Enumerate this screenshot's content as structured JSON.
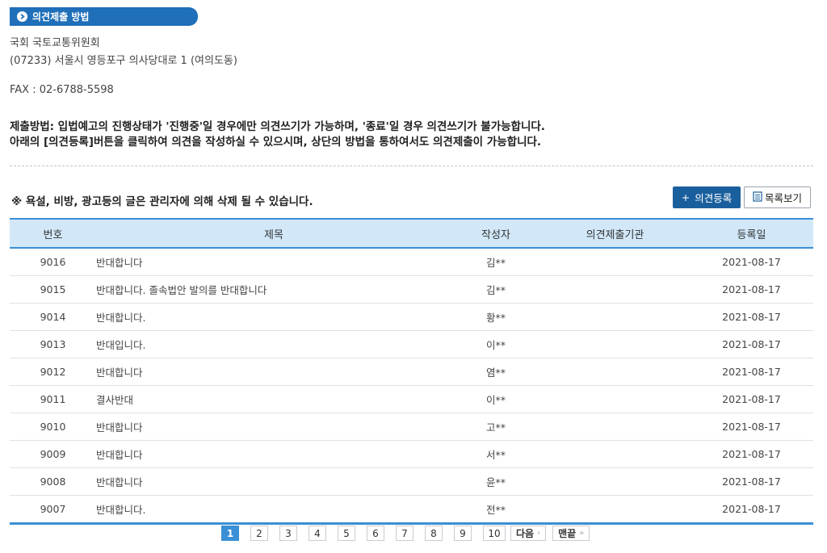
{
  "section": {
    "title": "의견제출 방법"
  },
  "address": {
    "org": "국회 국토교통위원회",
    "street": "(07233) 서울시 영등포구 의사당대로 1 (여의도동)",
    "fax": "FAX : 02-6788-5598"
  },
  "notice": {
    "line1": "제출방법: 입법예고의 진행상태가 '진행중'일 경우에만 의견쓰기가 가능하며, '종료'일 경우 의견쓰기가 불가능합니다.",
    "line2": "아래의 [의견등록]버튼을 클릭하여 의견을 작성하실 수 있으시며, 상단의 방법을 통하여서도 의견제출이 가능합니다."
  },
  "warning": "※ 욕설, 비방, 광고등의 글은 관리자에 의해 삭제 될 수 있습니다.",
  "buttons": {
    "register": "의견등록",
    "list": "목록보기"
  },
  "table": {
    "headers": {
      "no": "번호",
      "title": "제목",
      "author": "작성자",
      "org": "의견제출기관",
      "date": "등록일"
    },
    "rows": [
      {
        "no": "9016",
        "title": "반대합니다",
        "author": "김**",
        "org": "",
        "date": "2021-08-17"
      },
      {
        "no": "9015",
        "title": "반대합니다. 졸속법안 발의를 반대합니다",
        "author": "김**",
        "org": "",
        "date": "2021-08-17"
      },
      {
        "no": "9014",
        "title": "반대합니다.",
        "author": "황**",
        "org": "",
        "date": "2021-08-17"
      },
      {
        "no": "9013",
        "title": "반대입니다.",
        "author": "이**",
        "org": "",
        "date": "2021-08-17"
      },
      {
        "no": "9012",
        "title": "반대합니다",
        "author": "염**",
        "org": "",
        "date": "2021-08-17"
      },
      {
        "no": "9011",
        "title": "결사반대",
        "author": "이**",
        "org": "",
        "date": "2021-08-17"
      },
      {
        "no": "9010",
        "title": "반대합니다",
        "author": "고**",
        "org": "",
        "date": "2021-08-17"
      },
      {
        "no": "9009",
        "title": "반대합니다",
        "author": "서**",
        "org": "",
        "date": "2021-08-17"
      },
      {
        "no": "9008",
        "title": "반대합니다",
        "author": "윤**",
        "org": "",
        "date": "2021-08-17"
      },
      {
        "no": "9007",
        "title": "반대합니다.",
        "author": "전**",
        "org": "",
        "date": "2021-08-17"
      }
    ]
  },
  "pagination": {
    "pages": [
      "1",
      "2",
      "3",
      "4",
      "5",
      "6",
      "7",
      "8",
      "9",
      "10"
    ],
    "current": "1",
    "next": "다음",
    "last": "맨끝"
  }
}
